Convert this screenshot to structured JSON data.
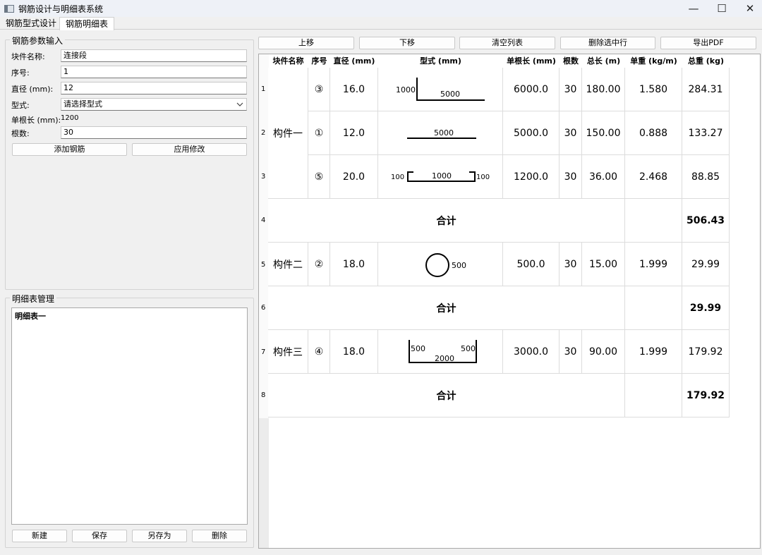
{
  "window": {
    "title": "钢筋设计与明细表系统",
    "minimize_glyph": "—",
    "maximize_glyph": "☐",
    "close_glyph": "✕"
  },
  "tabs": [
    {
      "label": "钢筋型式设计"
    },
    {
      "label": "钢筋明细表"
    }
  ],
  "params": {
    "group_title": "钢筋参数输入",
    "block_name_label": "块件名称:",
    "block_name_value": "连接段",
    "seq_label": "序号:",
    "seq_value": "1",
    "diameter_label": "直径 (mm):",
    "diameter_value": "12",
    "shape_label": "型式:",
    "shape_value": "请选择型式",
    "single_length_label": "单根长 (mm):",
    "single_length_value": "1200",
    "count_label": "根数:",
    "count_value": "30",
    "add_button": "添加钢筋",
    "apply_button": "应用修改"
  },
  "manage": {
    "group_title": "明细表管理",
    "items": [
      "明细表一"
    ],
    "new_button": "新建",
    "save_button": "保存",
    "save_as_button": "另存为",
    "delete_button": "删除"
  },
  "toolbar": {
    "up": "上移",
    "down": "下移",
    "clear": "清空列表",
    "delete_selected": "删除选中行",
    "export_pdf": "导出PDF"
  },
  "table": {
    "headers": [
      "块件名称",
      "序号",
      "直径 (mm)",
      "型式 (mm)",
      "单根长 (mm)",
      "根数",
      "总长 (m)",
      "单重 (kg/m)",
      "总重 (kg)"
    ],
    "row_numbers": [
      "1",
      "2",
      "3",
      "4",
      "5",
      "6",
      "7",
      "8"
    ],
    "rows": [
      {
        "block": "构件一",
        "seq": "③",
        "diameter": "16.0",
        "shape": "L",
        "shape_labels": [
          "1000",
          "5000"
        ],
        "length": "6000.0",
        "count": "30",
        "total_len": "180.00",
        "unit_wt": "1.580",
        "total_wt": "284.31"
      },
      {
        "block": "",
        "seq": "①",
        "diameter": "12.0",
        "shape": "straight",
        "shape_labels": [
          "5000"
        ],
        "length": "5000.0",
        "count": "30",
        "total_len": "150.00",
        "unit_wt": "0.888",
        "total_wt": "133.27"
      },
      {
        "block": "",
        "seq": "⑤",
        "diameter": "20.0",
        "shape": "hook",
        "shape_labels": [
          "100",
          "1000",
          "100"
        ],
        "length": "1200.0",
        "count": "30",
        "total_len": "36.00",
        "unit_wt": "2.468",
        "total_wt": "88.85"
      },
      {
        "subtotal_label": "合计",
        "subtotal_value": "506.43"
      },
      {
        "block": "构件二",
        "seq": "②",
        "diameter": "18.0",
        "shape": "circle",
        "shape_labels": [
          "500"
        ],
        "length": "500.0",
        "count": "30",
        "total_len": "15.00",
        "unit_wt": "1.999",
        "total_wt": "29.99"
      },
      {
        "subtotal_label": "合计",
        "subtotal_value": "29.99"
      },
      {
        "block": "构件三",
        "seq": "④",
        "diameter": "18.0",
        "shape": "U",
        "shape_labels": [
          "500",
          "2000",
          "500"
        ],
        "length": "3000.0",
        "count": "30",
        "total_len": "90.00",
        "unit_wt": "1.999",
        "total_wt": "179.92"
      },
      {
        "subtotal_label": "合计",
        "subtotal_value": "179.92"
      }
    ]
  }
}
